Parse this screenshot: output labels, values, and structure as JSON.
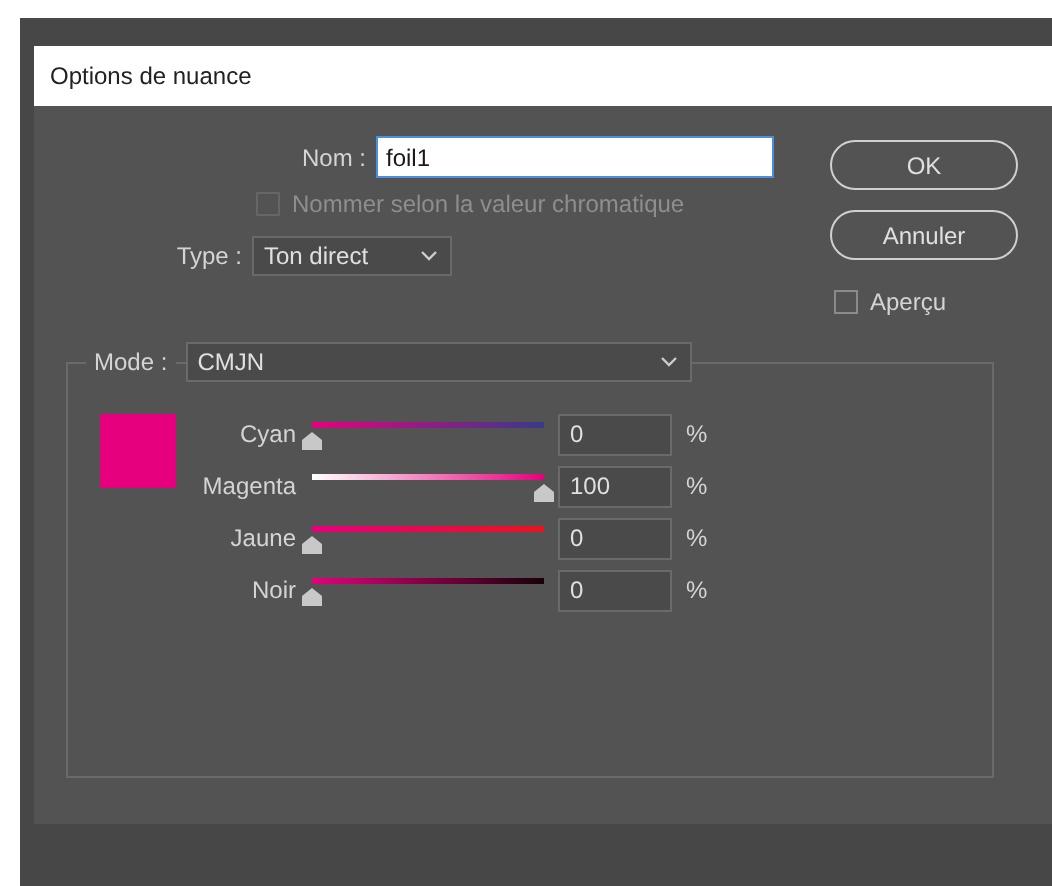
{
  "window": {
    "title": "Options de nuance"
  },
  "name_field": {
    "label": "Nom :",
    "value": "foil1"
  },
  "name_by_value": {
    "label": "Nommer selon la valeur chromatique",
    "checked": false,
    "disabled": true
  },
  "type_field": {
    "label": "Type :",
    "value": "Ton direct"
  },
  "buttons": [
    {
      "label": "OK"
    },
    {
      "label": "Annuler"
    }
  ],
  "preview": {
    "label": "Aperçu",
    "checked": false
  },
  "mode_field": {
    "label": "Mode :",
    "value": "CMJN"
  },
  "swatch": {
    "color": "#e6007e"
  },
  "channels": [
    {
      "name": "Cyan",
      "level": 0,
      "value": "0",
      "unit": "%"
    },
    {
      "name": "Magenta",
      "level": 1,
      "value": "100",
      "unit": "%"
    },
    {
      "name": "Jaune",
      "level": 0,
      "value": "0",
      "unit": "%"
    },
    {
      "name": "Noir",
      "level": 0,
      "value": "0",
      "unit": "%"
    }
  ]
}
